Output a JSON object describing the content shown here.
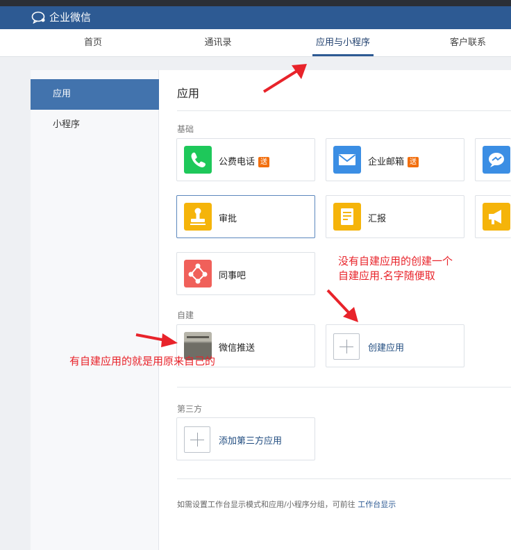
{
  "app": {
    "title": "企业微信"
  },
  "nav": {
    "tabs": [
      {
        "label": "首页"
      },
      {
        "label": "通讯录"
      },
      {
        "label": "应用与小程序"
      },
      {
        "label": "客户联系"
      }
    ],
    "active": "应用与小程序"
  },
  "sidebar": {
    "items": [
      {
        "label": "应用",
        "active": true
      },
      {
        "label": "小程序",
        "active": false
      }
    ]
  },
  "main": {
    "title": "应用",
    "sections": {
      "basic": "基础",
      "custom": "自建",
      "third_party": "第三方"
    },
    "apps": {
      "phone": {
        "label": "公费电话",
        "badge": "送",
        "icon": "phone-icon",
        "color": "#1ec85a"
      },
      "mail": {
        "label": "企业邮箱",
        "badge": "送",
        "icon": "mail-icon",
        "color": "#3b8ee4"
      },
      "approval": {
        "label": "审批",
        "icon": "stamp-icon",
        "color": "#f5b40a"
      },
      "report": {
        "label": "汇报",
        "icon": "report-icon",
        "color": "#f5b40a"
      },
      "colleague": {
        "label": "同事吧",
        "icon": "colleague-icon",
        "color": "#f0605a"
      },
      "wechat_push": {
        "label": "微信推送",
        "icon": "custom-app-thumbnail"
      },
      "create_app": {
        "label": "创建应用",
        "icon": "plus-icon"
      },
      "add_third": {
        "label": "添加第三方应用",
        "icon": "plus-icon"
      }
    },
    "footer": {
      "text": "如需设置工作台显示模式和应用/小程序分组，可前往",
      "link": "工作台显示"
    }
  },
  "annotations": {
    "note1_line1": "没有自建应用的创建一个",
    "note1_line2": "自建应用.名字随便取",
    "note2": "有自建应用的就是用原来自己的"
  },
  "colors": {
    "brand": "#2d5a93",
    "sidebar_active": "#4273ad",
    "annotation": "#e8232a"
  }
}
